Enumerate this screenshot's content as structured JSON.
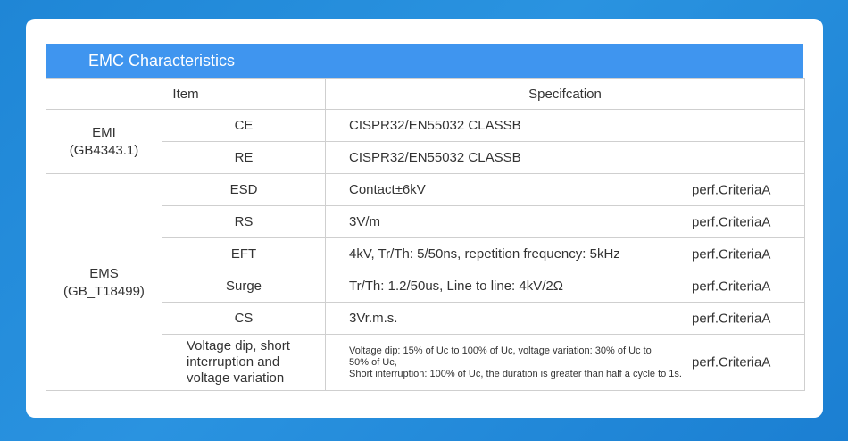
{
  "title": "EMC Characteristics",
  "header": {
    "item": "Item",
    "spec": "Specifcation"
  },
  "emi": {
    "group_label": "EMI",
    "group_std": "(GB4343.1)",
    "rows": [
      {
        "item": "CE",
        "spec": "CISPR32/EN55032  CLASSB"
      },
      {
        "item": "RE",
        "spec": "CISPR32/EN55032  CLASSB"
      }
    ]
  },
  "ems": {
    "group_label": "EMS",
    "group_std": "(GB_T18499)",
    "rows": [
      {
        "item": "ESD",
        "spec": "Contact±6kV",
        "perf": "perf.CriteriaA"
      },
      {
        "item": "RS",
        "spec": "3V/m",
        "perf": "perf.CriteriaA"
      },
      {
        "item": "EFT",
        "spec": "4kV, Tr/Th: 5/50ns, repetition frequency: 5kHz",
        "perf": "perf.CriteriaA"
      },
      {
        "item": "Surge",
        "spec": "Tr/Th: 1.2/50us, Line to line: 4kV/2Ω",
        "perf": "perf.CriteriaA"
      },
      {
        "item": "CS",
        "spec": "3Vr.m.s.",
        "perf": "perf.CriteriaA"
      }
    ],
    "vd": {
      "item_line1": "Voltage dip, short",
      "item_line2": "interruption and",
      "item_line3": "voltage variation",
      "spec_line1": "Voltage dip: 15% of Uc to 100% of Uc, voltage variation: 30% of Uc to",
      "spec_line2": "50% of Uc,",
      "spec_line3": "Short interruption: 100% of Uc, the duration is greater than half a cycle to 1s.",
      "perf": "perf.CriteriaA"
    }
  }
}
